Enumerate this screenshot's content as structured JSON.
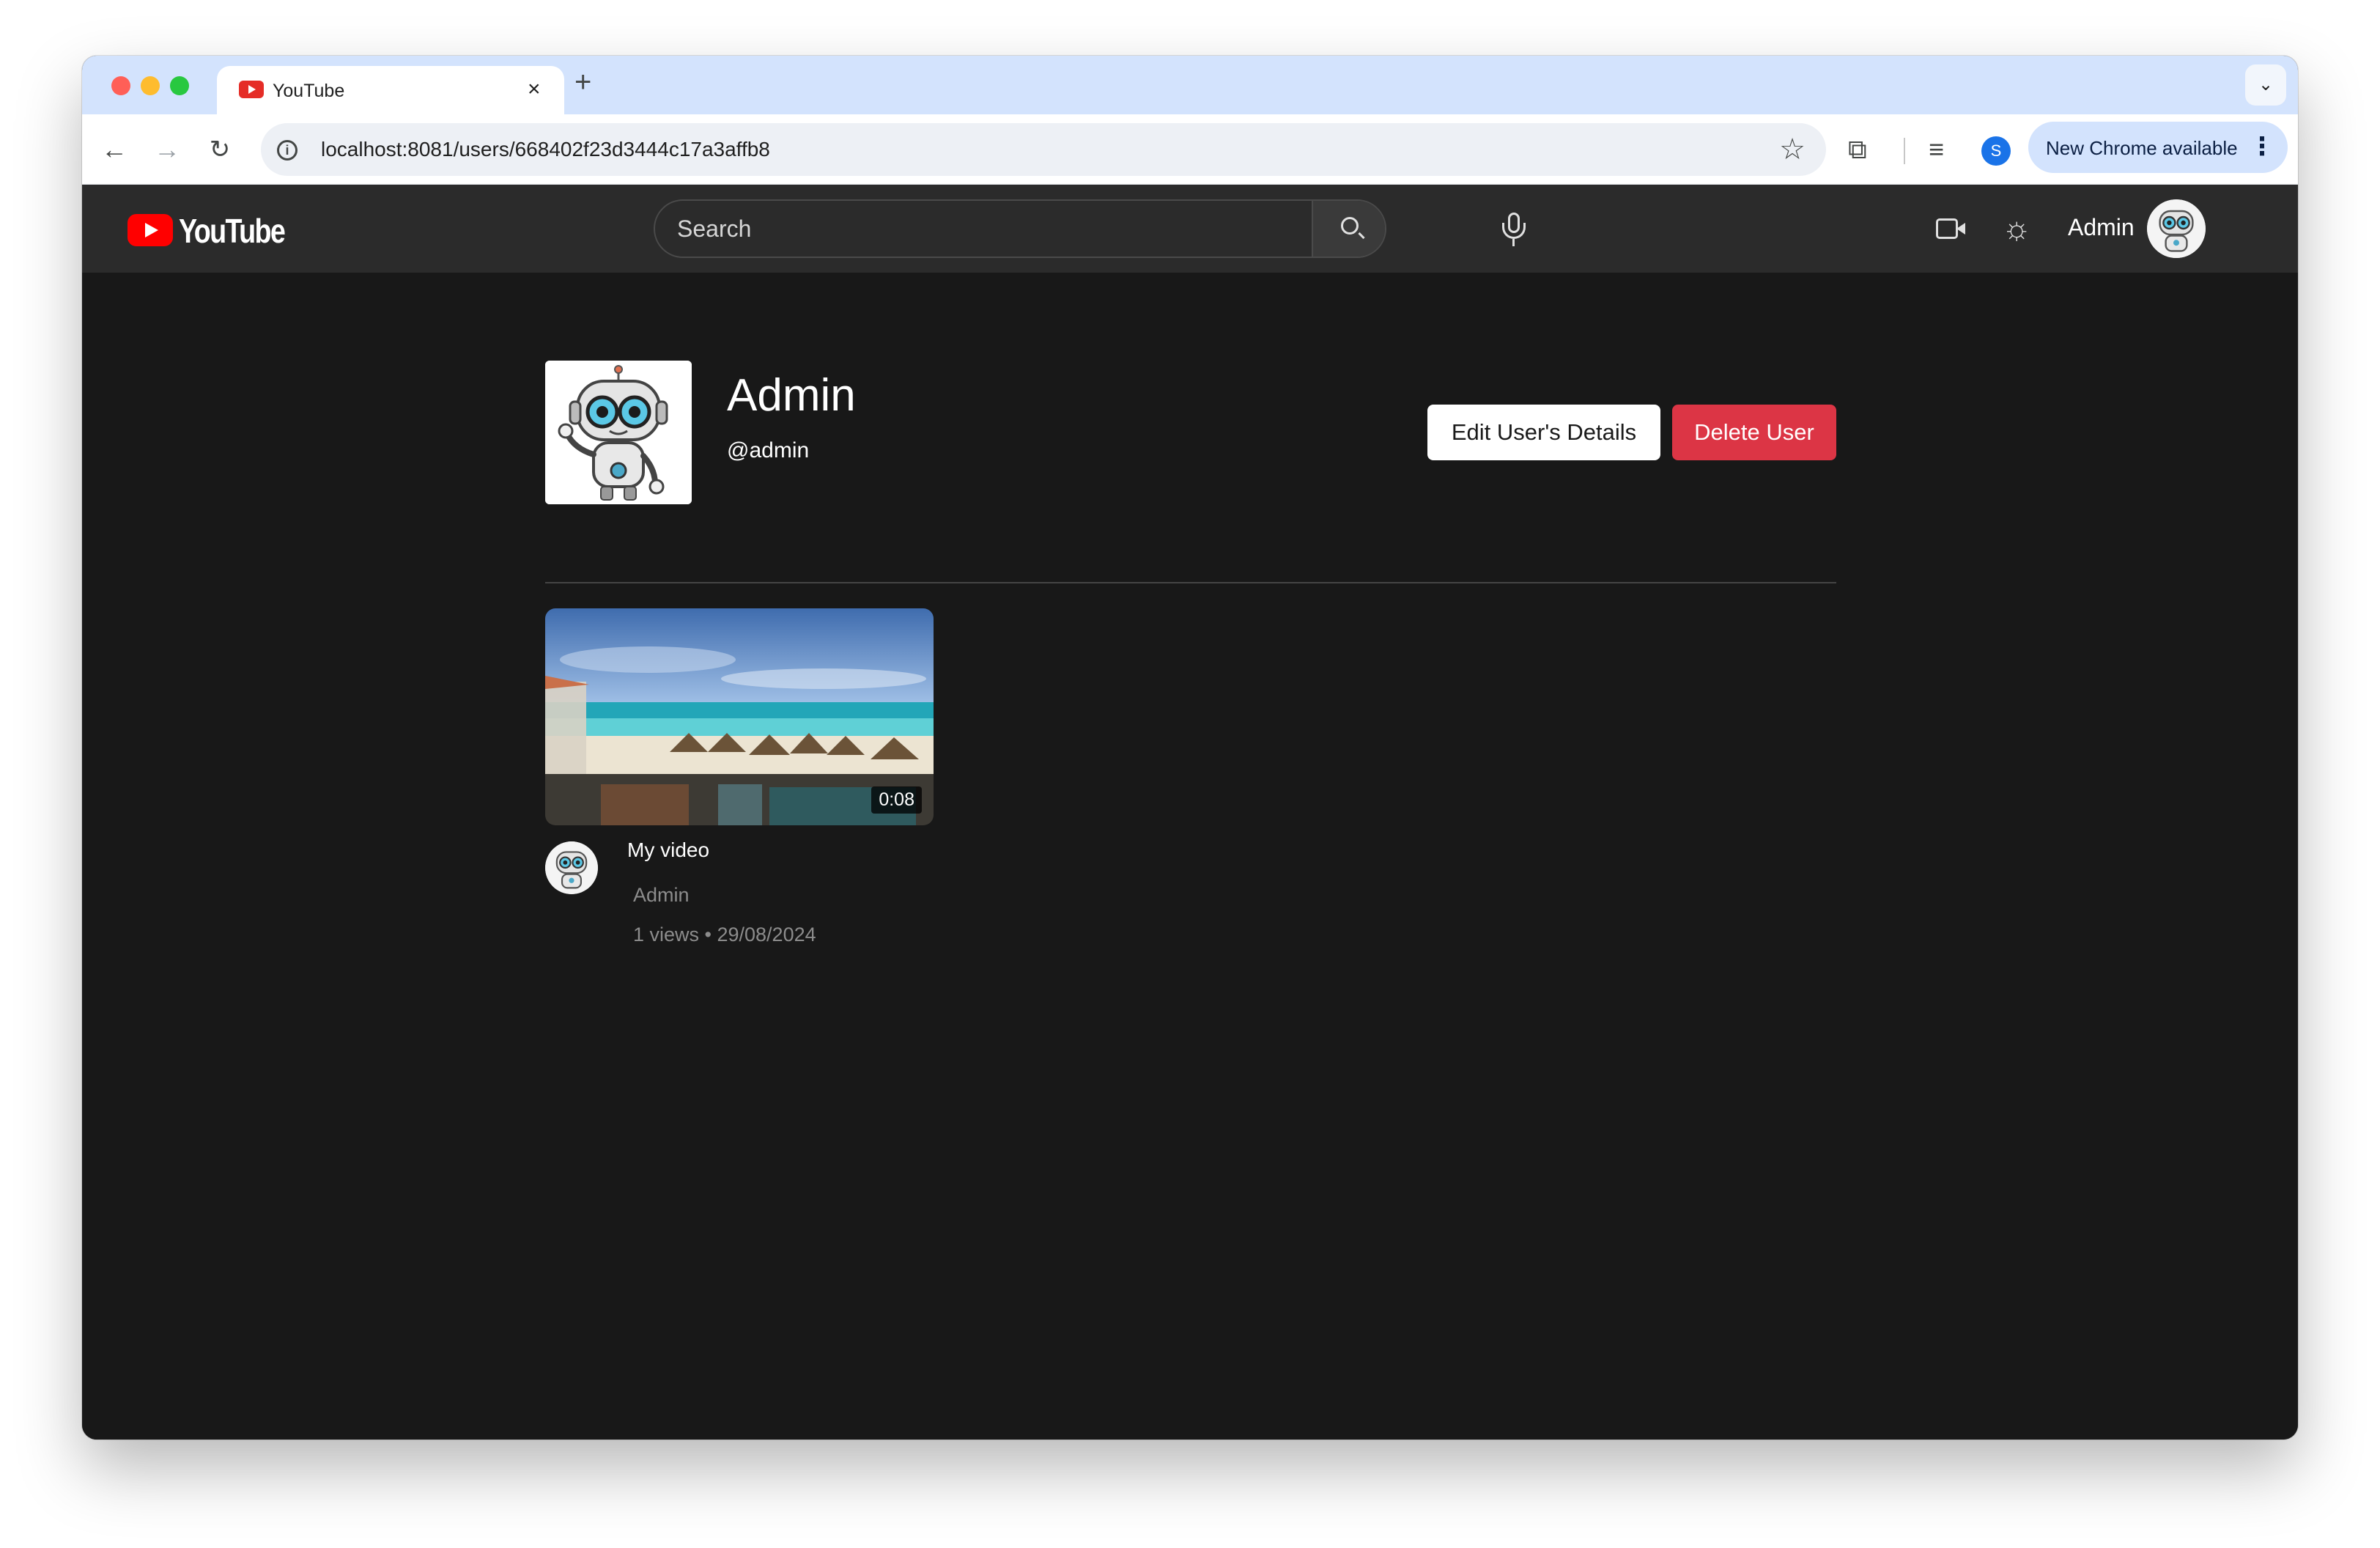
{
  "browser": {
    "tab_title": "YouTube",
    "close_glyph": "×",
    "new_tab_glyph": "+",
    "tab_menu_glyph": "⌄",
    "url": "localhost:8081/users/668402f23d3444c17a3affb8",
    "profile_initial": "S",
    "update_label": "New Chrome available",
    "menu_glyph": "⋮",
    "nav": {
      "back": "←",
      "forward": "→",
      "reload": "↻"
    },
    "star_glyph": "☆",
    "extensions_glyph": "⧉",
    "media_glyph": "≡",
    "info_glyph": "i"
  },
  "header": {
    "logo_text": "YouTube",
    "search_placeholder": "Search",
    "theme_glyph": "☼",
    "username": "Admin",
    "colors": {
      "brand": "#ff0000",
      "bar": "#2b2b2b"
    }
  },
  "profile": {
    "name": "Admin",
    "handle": "@admin",
    "edit_label": "Edit User's Details",
    "delete_label": "Delete User",
    "colors": {
      "delete": "#dc3545"
    }
  },
  "videos": [
    {
      "title": "My video",
      "channel": "Admin",
      "meta": "1 views • 29/08/2024",
      "duration": "0:08"
    }
  ]
}
